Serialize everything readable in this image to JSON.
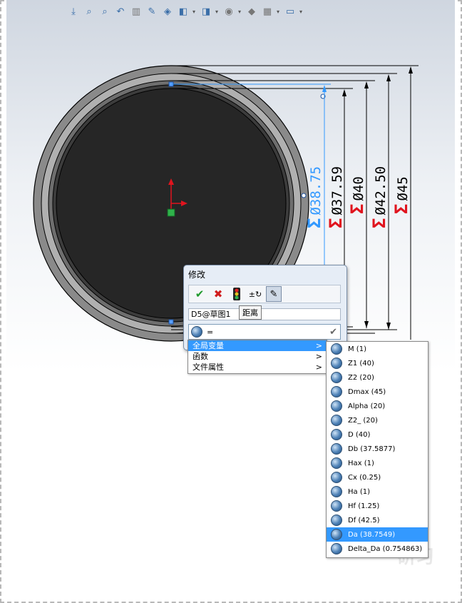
{
  "dimensions": [
    {
      "label": "Ø38.75",
      "prefix": "Σ",
      "color": "#3399ff",
      "prefix_color": "#3399ff"
    },
    {
      "label": "Ø37.59",
      "prefix": "Σ",
      "color": "#000000",
      "prefix_color": "#e0141e"
    },
    {
      "label": "Ø40",
      "prefix": "Σ",
      "color": "#000000",
      "prefix_color": "#e0141e"
    },
    {
      "label": "Ø42.50",
      "prefix": "Σ",
      "color": "#000000",
      "prefix_color": "#e0141e"
    },
    {
      "label": "Ø45",
      "prefix": "Σ",
      "color": "#000000",
      "prefix_color": "#e0141e"
    }
  ],
  "modify_dialog": {
    "title": "修改",
    "dimension_name": "D5@草图1",
    "value": "=",
    "tooltip": "距离"
  },
  "context_menu": [
    {
      "label": "全局变量",
      "arrow": ">",
      "selected": true
    },
    {
      "label": "函数",
      "arrow": ">",
      "selected": false
    },
    {
      "label": "文件属性",
      "arrow": ">",
      "selected": false
    }
  ],
  "global_variables": [
    {
      "label": "M (1)",
      "selected": false
    },
    {
      "label": "Z1 (40)",
      "selected": false
    },
    {
      "label": "Z2 (20)",
      "selected": false
    },
    {
      "label": "Dmax (45)",
      "selected": false
    },
    {
      "label": "Alpha (20)",
      "selected": false
    },
    {
      "label": "Z2_ (20)",
      "selected": false
    },
    {
      "label": "D (40)",
      "selected": false
    },
    {
      "label": "Db (37.5877)",
      "selected": false
    },
    {
      "label": "Hax (1)",
      "selected": false
    },
    {
      "label": "Cx (0.25)",
      "selected": false
    },
    {
      "label": "Ha (1)",
      "selected": false
    },
    {
      "label": "Hf (1.25)",
      "selected": false
    },
    {
      "label": "Df (42.5)",
      "selected": false
    },
    {
      "label": "Da (38.7549)",
      "selected": true
    },
    {
      "label": "Delta_Da (0.754863)",
      "selected": false
    }
  ],
  "colors": {
    "accent": "#3399ff",
    "sigma_red": "#e0141e",
    "disk_fill": "#262626"
  },
  "icons": [
    "view-orient-icon",
    "zoom-fit-icon",
    "zoom-area-icon",
    "previous-view-icon",
    "section-view-icon",
    "dynamic-annotation-icon",
    "view-cube-icon",
    "display-style-icon",
    "hide-show-icon",
    "appearance-icon",
    "scene-icon",
    "monitor-icon"
  ]
}
